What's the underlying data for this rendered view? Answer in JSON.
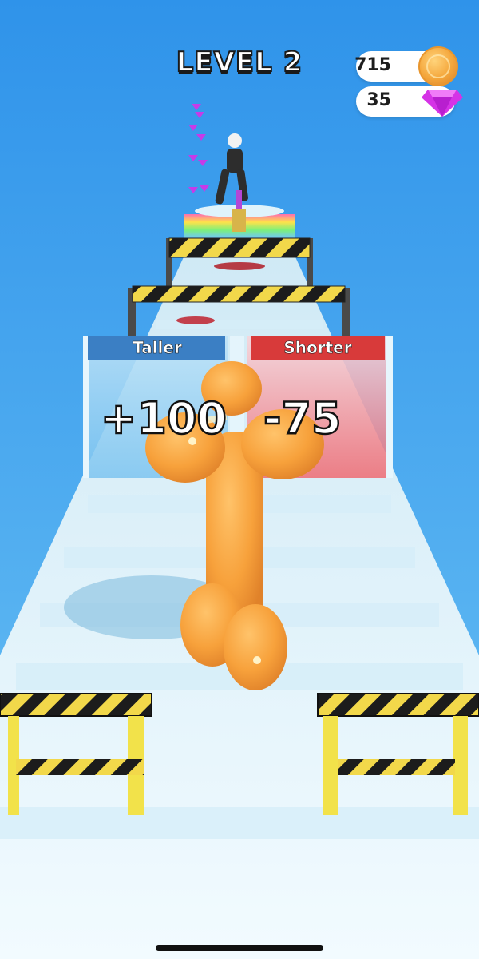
{
  "hud": {
    "level_label": "LEVEL 2",
    "coins": "715",
    "gems": "35",
    "coin_icon": "gold-coin-icon",
    "gem_icon": "pink-gem-icon"
  },
  "gates": {
    "left": {
      "label": "Taller",
      "value": "+100",
      "color": "#3b7fc4"
    },
    "right": {
      "label": "Shorter",
      "value": "-75",
      "color": "#d83a3a"
    }
  },
  "colors": {
    "sky": "#3a9ff0",
    "track": "#eaf6fb",
    "player": "#f5a13a",
    "gem": "#c63be8",
    "hazard_yellow": "#f2e24a"
  }
}
